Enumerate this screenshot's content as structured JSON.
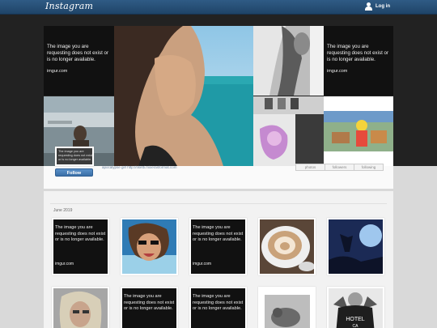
{
  "topbar": {
    "logo": "Instagram",
    "login_label": "Log in"
  },
  "unavailable": {
    "message": "The image you are requesting does not exist or is no longer available.",
    "source": "imgur.com"
  },
  "profile": {
    "follow_label": "Follow",
    "bio": "apocalypse girl http://sketti.mixerasformat.com",
    "avatar_message": "The image you are requesting does not exist or is no longer available.",
    "stats": [
      "photos",
      "followers",
      "following"
    ]
  },
  "grid": {
    "month_label": "June 2019"
  },
  "colors": {
    "topbar": "#2f5b85",
    "hero_bg": "#222222",
    "follow": "#3a6fa7"
  }
}
